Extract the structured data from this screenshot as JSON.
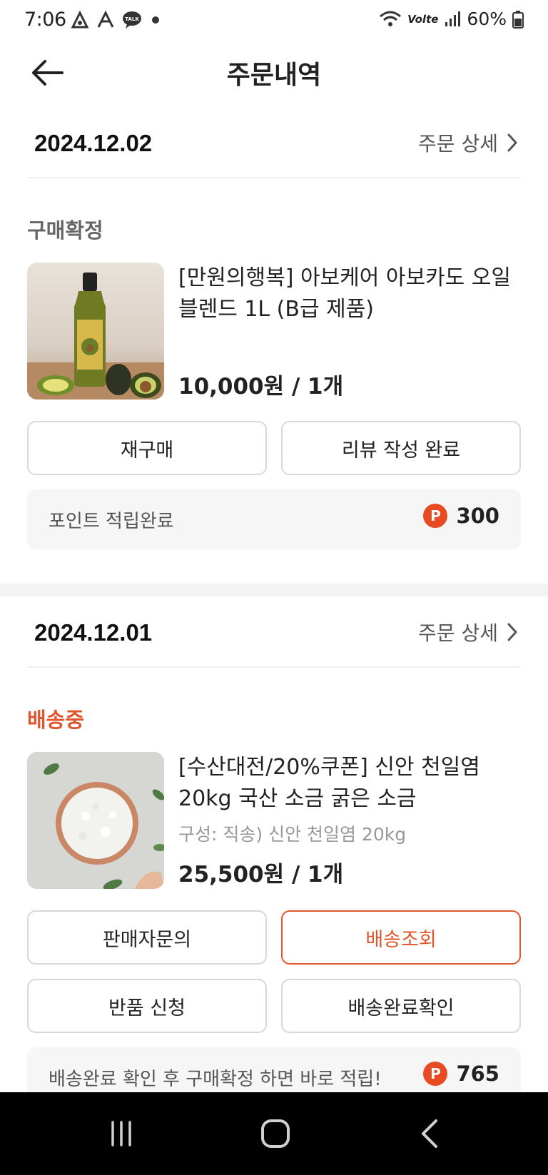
{
  "status_bar": {
    "time": "7:06",
    "left_icons": [
      "app-notification-icon",
      "app-notification-icon",
      "kakaotalk-icon",
      "dot-icon"
    ],
    "battery": "60%",
    "network": "Volte"
  },
  "header": {
    "title": "주문내역",
    "back_icon": "arrow-left-icon"
  },
  "orders": [
    {
      "date": "2024.12.02",
      "detail_label": "주문 상세",
      "status": "구매확정",
      "status_color": "#666666",
      "product_name": "[만원의행복] 아보케어 아보카도 오일 블렌드 1L (B급 제품)",
      "product_image": "avocado-oil-bottle-image",
      "price": "10,000원 / 1개",
      "buttons": [
        "재구매",
        "리뷰 작성 완료"
      ],
      "point_label": "포인트 적립완료",
      "point_badge": "P",
      "point_value": "300"
    },
    {
      "date": "2024.12.01",
      "detail_label": "주문 상세",
      "status": "배송중",
      "status_color": "#e0552b",
      "product_name": "[수산대전/20%쿠폰] 신안 천일염 20kg 국산 소금 굵은 소금",
      "product_image": "sea-salt-bowl-image",
      "option": "구성: 직송) 신안 천일염 20kg",
      "price": "25,500원 / 1개",
      "buttons": [
        "판매자문의",
        "배송조회",
        "반품 신청",
        "배송완료확인"
      ],
      "point_label": "배송완료 확인 후 구매확정 하면 바로 적립!",
      "point_badge": "P",
      "point_value": "765"
    }
  ],
  "nav_bar": {
    "buttons": [
      "recent-apps-icon",
      "home-icon",
      "back-icon"
    ]
  },
  "colors": {
    "accent": "#e0552b",
    "point_badge": "#e94a22"
  }
}
